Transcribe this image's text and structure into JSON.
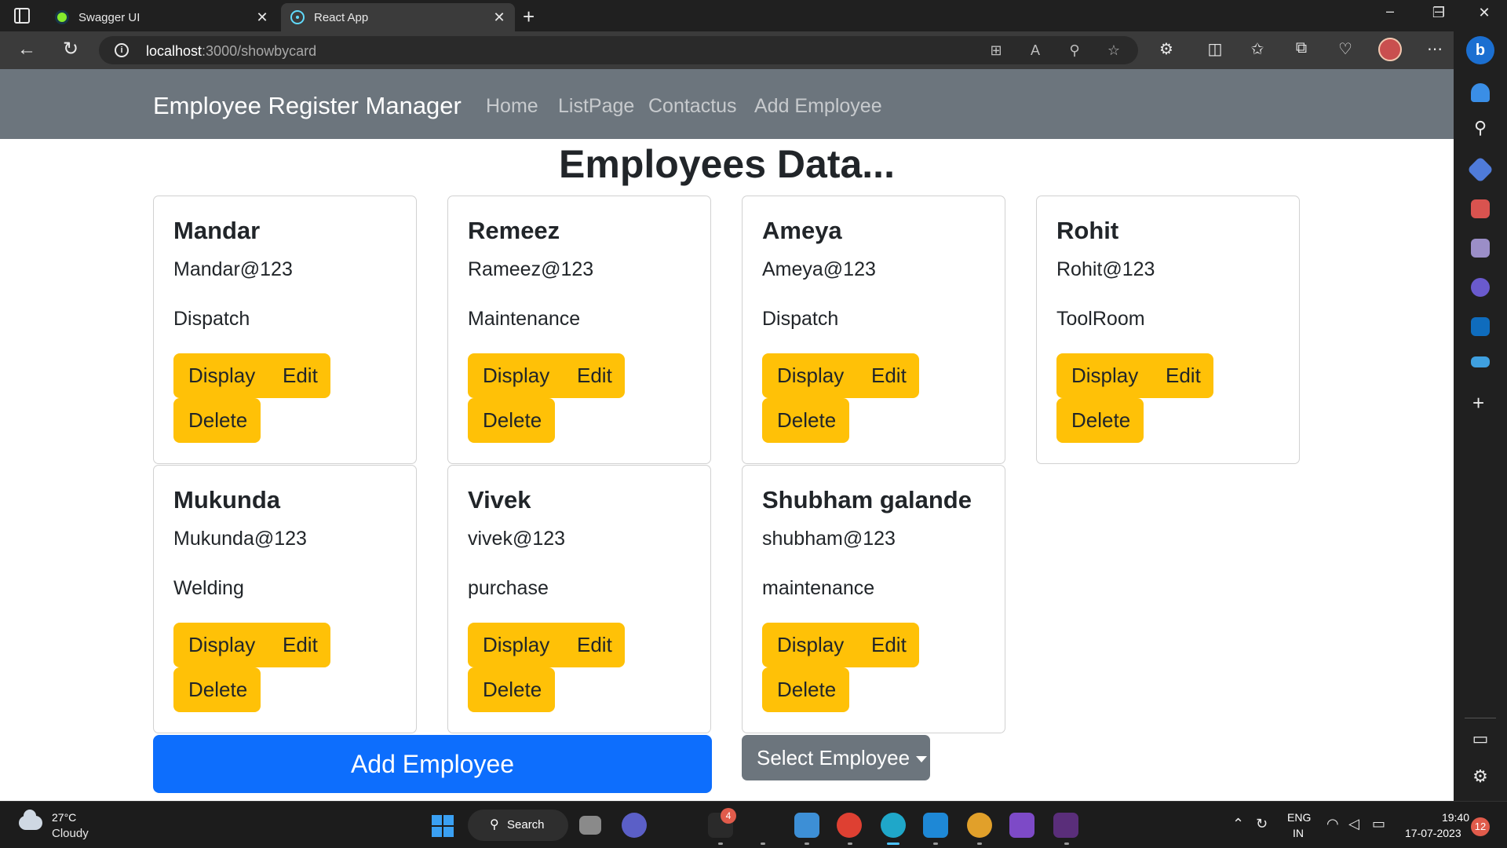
{
  "browser": {
    "tabs": [
      {
        "title": "Swagger UI",
        "active": false
      },
      {
        "title": "React App",
        "active": true
      }
    ],
    "url_host": "localhost",
    "url_path": ":3000/showbycard"
  },
  "navbar": {
    "brand": "Employee Register Manager",
    "links": [
      "Home",
      "ListPage",
      "Contactus",
      "Add Employee"
    ]
  },
  "page": {
    "title": "Employees Data..."
  },
  "buttons": {
    "display": "Display",
    "edit": "Edit",
    "delete": "Delete",
    "add_employee": "Add Employee",
    "select_employee": "Select Employee"
  },
  "employees": [
    {
      "name": "Mandar",
      "email": "Mandar@123",
      "department": "Dispatch"
    },
    {
      "name": "Remeez",
      "email": "Rameez@123",
      "department": "Maintenance"
    },
    {
      "name": "Ameya",
      "email": "Ameya@123",
      "department": "Dispatch"
    },
    {
      "name": "Rohit",
      "email": "Rohit@123",
      "department": "ToolRoom"
    },
    {
      "name": "Mukunda",
      "email": "Mukunda@123",
      "department": "Welding"
    },
    {
      "name": "Vivek",
      "email": "vivek@123",
      "department": "purchase"
    },
    {
      "name": "Shubham galande",
      "email": "shubham@123",
      "department": "maintenance"
    }
  ],
  "colors": {
    "navbar": "#6c757d",
    "warning_button": "#ffc107",
    "primary_button": "#0d6efd",
    "secondary_button": "#6c757d"
  },
  "taskbar": {
    "temperature": "27°C",
    "condition": "Cloudy",
    "search_label": "Search",
    "notification_count": "4",
    "language_1": "ENG",
    "language_2": "IN",
    "time": "19:40",
    "date": "17-07-2023",
    "notification_badge": "12"
  }
}
